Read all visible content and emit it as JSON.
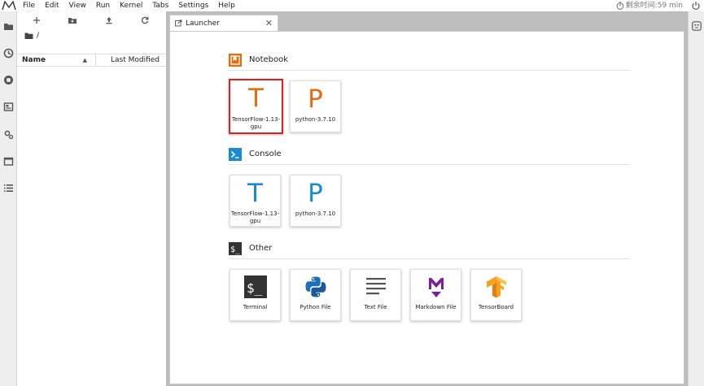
{
  "menu": [
    "File",
    "Edit",
    "View",
    "Run",
    "Kernel",
    "Tabs",
    "Settings",
    "Help"
  ],
  "timer": "剩余时间:59 min",
  "filebrowser": {
    "path": "/",
    "columns": {
      "name": "Name",
      "modified": "Last Modified"
    }
  },
  "tab": {
    "title": "Launcher"
  },
  "launcher": {
    "notebook": {
      "title": "Notebook",
      "cards": [
        {
          "letter": "T",
          "label": "TensorFlow-1.13-gpu"
        },
        {
          "letter": "P",
          "label": "python-3.7.10"
        }
      ]
    },
    "console": {
      "title": "Console",
      "cards": [
        {
          "letter": "T",
          "label": "TensorFlow-1.13-gpu"
        },
        {
          "letter": "P",
          "label": "python-3.7.10"
        }
      ]
    },
    "other": {
      "title": "Other",
      "cards": [
        {
          "label": "Terminal",
          "icon": "terminal-icon"
        },
        {
          "label": "Python File",
          "icon": "python-icon"
        },
        {
          "label": "Text File",
          "icon": "text-file-icon"
        },
        {
          "label": "Markdown File",
          "icon": "markdown-icon"
        },
        {
          "label": "TensorBoard",
          "icon": "tensorboard-icon"
        }
      ]
    }
  },
  "colors": {
    "notebook_accent": "#e46e0f",
    "console_accent": "#1a8ad3",
    "selected_border": "#e0201f",
    "markdown_purple": "#7b1fa2",
    "tensorboard_orange": "#f6a21b"
  }
}
